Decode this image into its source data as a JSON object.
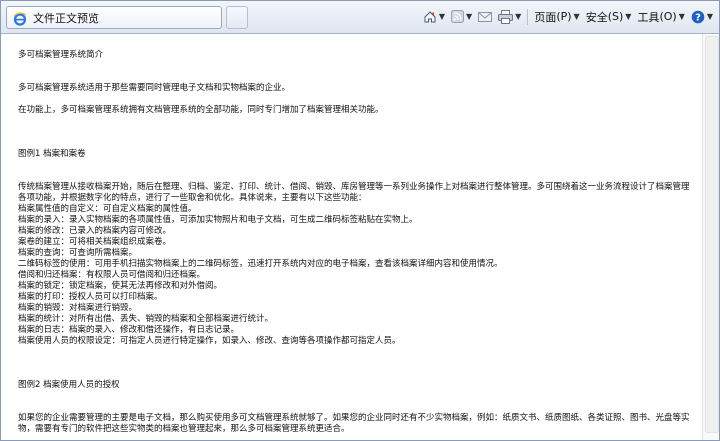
{
  "tab": {
    "title": "文件正文预览"
  },
  "commandbar": {
    "page_label": "页面",
    "page_key": "(P)",
    "safety_label": "安全",
    "safety_key": "(S)",
    "tools_label": "工具",
    "tools_key": "(O)"
  },
  "document": {
    "title": "多可档案管理系统简介",
    "intro": "多可档案管理系统适用于那些需要同时管理电子文档和实物档案的企业。",
    "features_intro": "在功能上，多可档案管理系统拥有文档管理系统的全部功能，同时专门增加了档案管理相关功能。",
    "section1_title": "图例1 档案和案卷",
    "section1_lines": [
      "传统档案管理从接收档案开始，随后在整理、归档、鉴定、打印、统计、借阅、销毁、库房管理等一系列业务操作上对档案进行整体管理。多可围绕着这一业务流程设计了档案管理各项功能，并根据数字化的特点，进行了一些取舍和优化。具体说来，主要有以下这些功能：",
      "档案属性值的自定义：可自定义档案的属性值。",
      "档案的录入：录入实物档案的各项属性值，可添加实物照片和电子文档，可生成二维码标签粘贴在实物上。",
      "档案的修改：已录入的档案内容可修改。",
      "案卷的建立：可将相关档案组织成案卷。",
      "档案的查询：可查询所需档案。",
      "二维码标签的使用：可用手机扫描实物档案上的二维码标签，迅速打开系统内对应的电子档案，查看该档案详细内容和使用情况。",
      "借阅和归还档案：有权限人员可借阅和归还档案。",
      "档案的锁定：锁定档案，使其无法再修改和对外借阅。",
      "档案的打印：授权人员可以打印档案。",
      "档案的销毁：对档案进行销毁。",
      "档案的统计：对所有出借、丢失、销毁的档案和全部档案进行统计。",
      "档案的日志：档案的录入、修改和借还操作，有日志记录。",
      "档案使用人员的权限设定：可指定人员进行特定操作，如录入、修改、查询等各项操作都可指定人员。"
    ],
    "section2_title": "图例2 档案使用人员的授权",
    "section2_lines": [
      "如果您的企业需要管理的主要是电子文档，那么购买使用多可文档管理系统就够了。如果您的企业同时还有不少实物档案，例如：纸质文书、纸质图纸、各类证照、图书、光盘等实物，需要有专门的软件把这些实物类的档案也管理起来，那么多可档案管理系统更适合。"
    ]
  },
  "colors": {
    "toolbar_top": "#f4f6fa",
    "toolbar_bottom": "#dfe6f1",
    "help_blue": "#1f5fbf",
    "ie_blue": "#2a78d6"
  }
}
